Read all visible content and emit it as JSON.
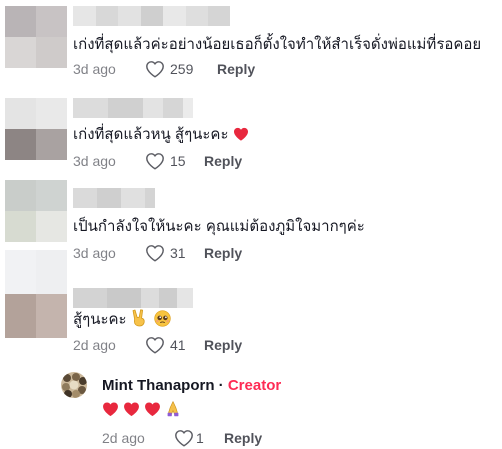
{
  "comments": [
    {
      "avatar_colors": [
        "#b9b4b6",
        "#c8c3c4",
        "#d9d6d5",
        "#cfcbca"
      ],
      "name_colors": [
        "#e6e6e6",
        "#d8d8d8",
        "#e2e2e2",
        "#cfcfcf",
        "#e8e8e8",
        "#dedede",
        "#d5d5d5"
      ],
      "text": "เก่งที่สุดแล้วค่ะอย่างน้อยเธอก็ตั้งใจทำให้สำเร็จดั่งพ่อแม่ที่รอคอย",
      "time": "3d ago",
      "likes": "259",
      "reply_label": "Reply"
    },
    {
      "avatar_colors": [
        "#e4e4e4",
        "#e9e9e9",
        "#8d8584",
        "#a9a2a1"
      ],
      "name_colors": [
        "#dcdcdc",
        "#d0d0d0",
        "#e3e3e3",
        "#d6d6d6",
        "#ebebeb"
      ],
      "text": "เก่งที่สุดแล้วหนู สู้ๆนะคะ",
      "time": "3d ago",
      "likes": "15",
      "reply_label": "Reply"
    },
    {
      "avatar_colors": [
        "#c9cdca",
        "#cfd3d1",
        "#d7dbd1",
        "#e6e7e3"
      ],
      "name_colors": [
        "#dadada",
        "#cfcfcf",
        "#e0e0e0",
        "#d4d4d4"
      ],
      "text": "เป็นกำลังใจให้นะคะ คุณแม่ต้องภูมิใจมากๆค่ะ",
      "time": "3d ago",
      "likes": "31",
      "reply_label": "Reply"
    },
    {
      "avatar_colors": [
        "#f1f2f4",
        "#eeeff1",
        "#b3a29a",
        "#c4b4ad"
      ],
      "name_colors": [
        "#d3d3d3",
        "#c9c9c9",
        "#dcdcdc",
        "#cdcdcd",
        "#e5e5e5"
      ],
      "text": "สู้ๆนะคะ",
      "time": "2d ago",
      "likes": "41",
      "reply_label": "Reply"
    }
  ],
  "creator_reply": {
    "name": "Mint Thanaporn",
    "separator": "·",
    "tag": "Creator",
    "time": "2d ago",
    "likes": "1",
    "reply_label": "Reply"
  },
  "colors": {
    "accent": "#fe2c55",
    "heart_emoji": "#e8283e",
    "text": "#161823",
    "muted": "#8a8b91"
  },
  "icons": {
    "like": "heart-outline-icon",
    "inline_heart": "red-heart-emoji",
    "victory": "victory-hand-emoji",
    "pleading": "pleading-face-emoji",
    "pray": "folded-hands-emoji"
  }
}
